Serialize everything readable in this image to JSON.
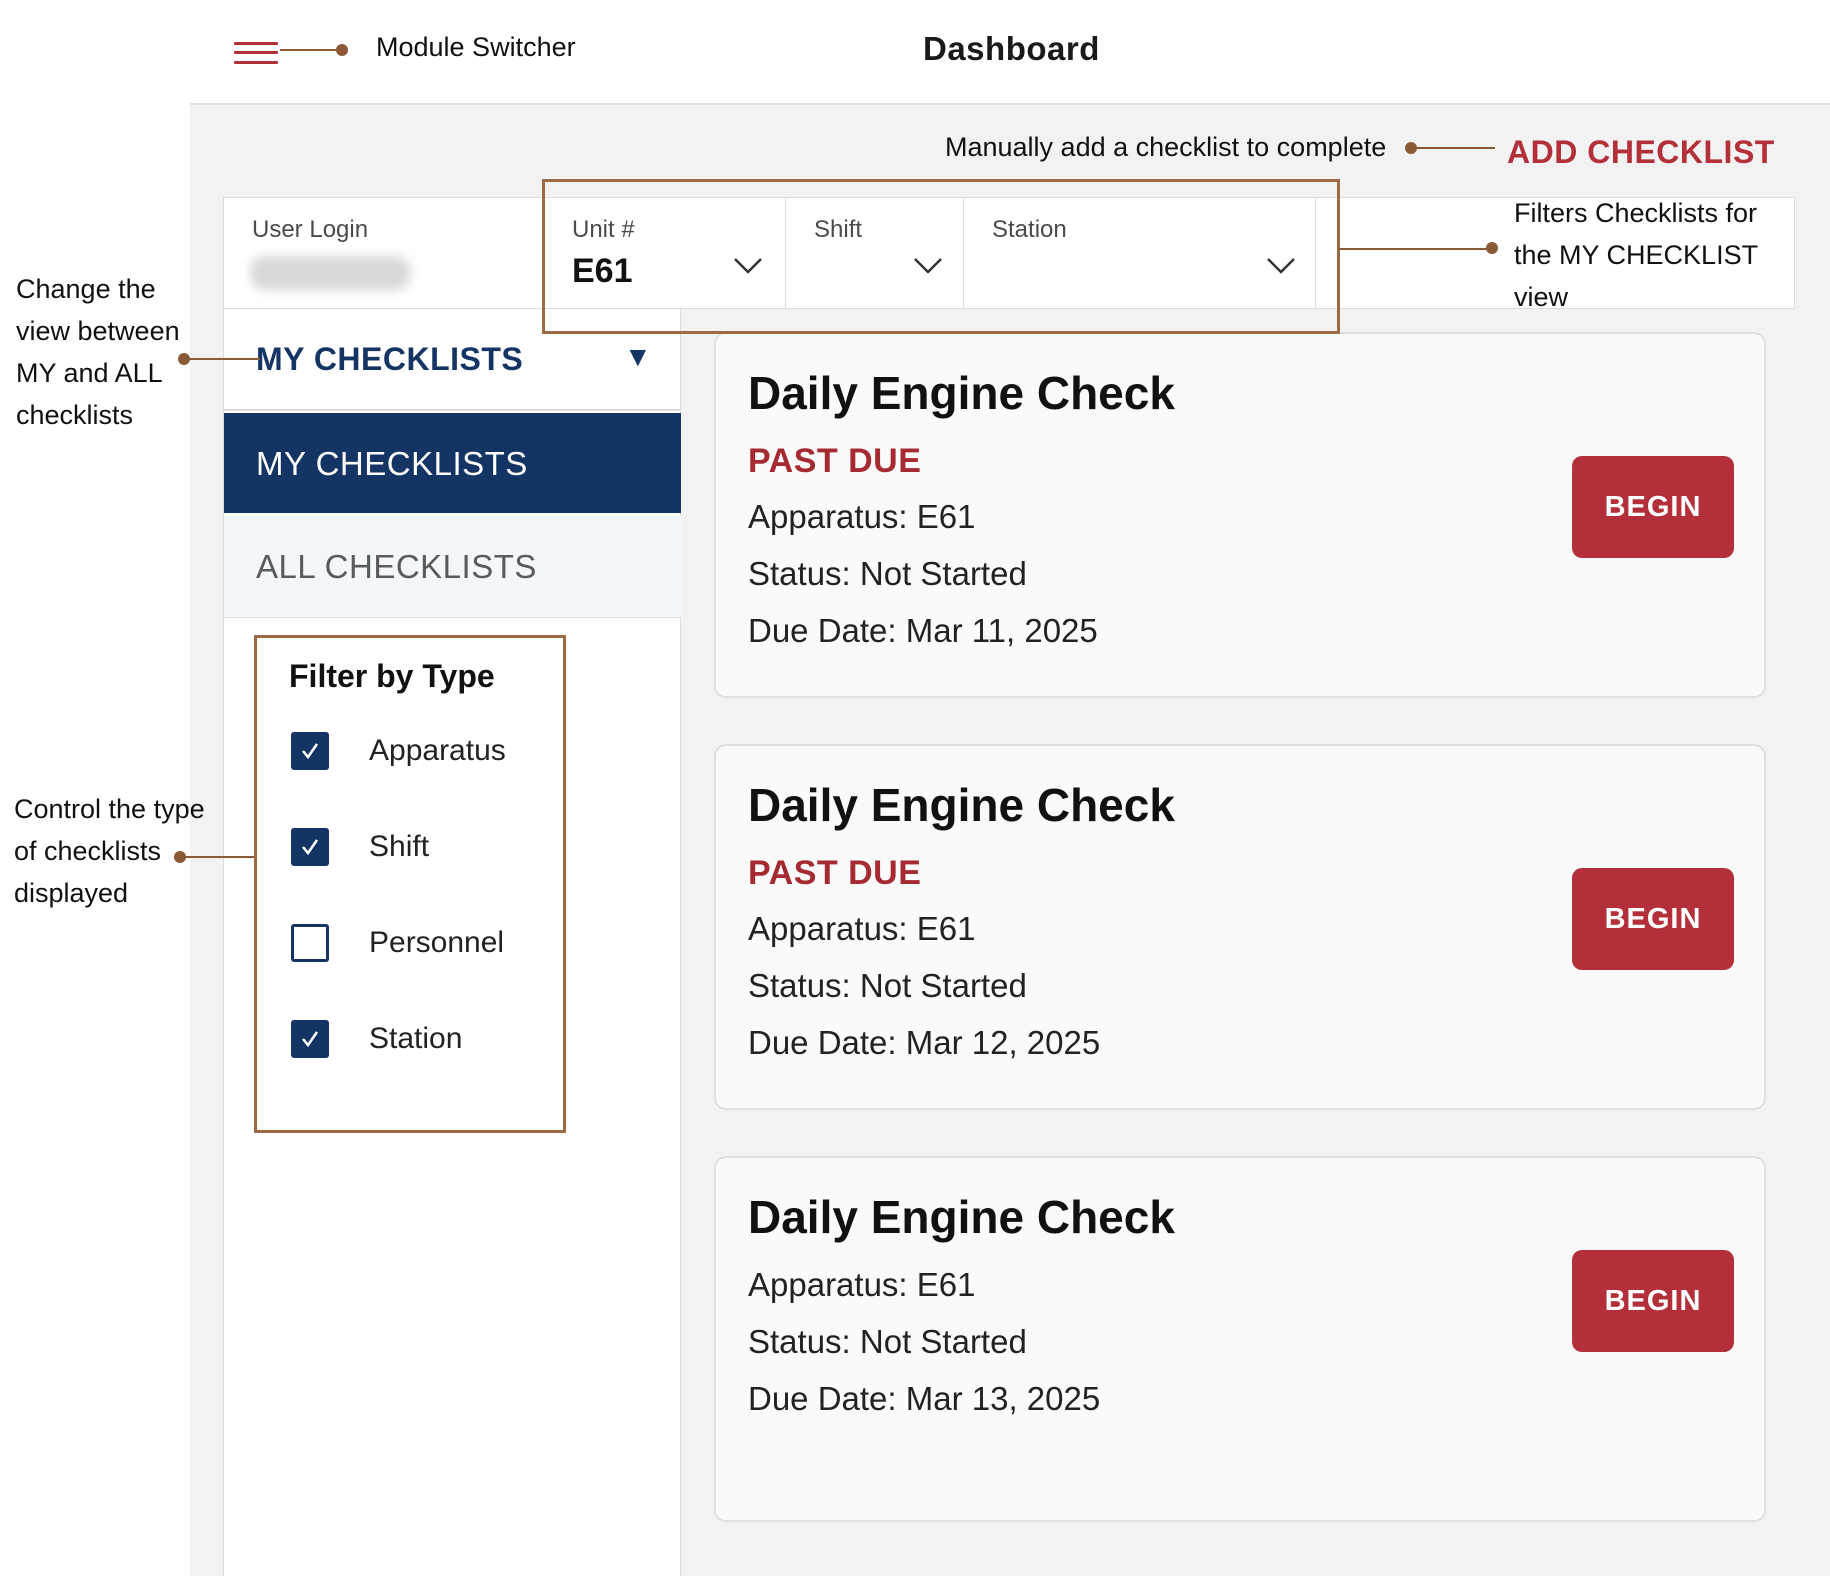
{
  "header": {
    "title": "Dashboard",
    "menu_icon": "hamburger-menu-icon",
    "accent_color": "#b3303a"
  },
  "toolbar": {
    "add_checklist_label": "ADD CHECKLIST"
  },
  "filters": {
    "user": {
      "label": "User Login",
      "value": ""
    },
    "unit": {
      "label": "Unit #",
      "value": "E61"
    },
    "shift": {
      "label": "Shift",
      "value": ""
    },
    "station": {
      "label": "Station",
      "value": ""
    }
  },
  "sidebar": {
    "view_selector": {
      "selected": "MY CHECKLISTS"
    },
    "view_options": [
      "MY CHECKLISTS",
      "ALL CHECKLISTS"
    ],
    "type_filter": {
      "title": "Filter by Type",
      "items": [
        {
          "label": "Apparatus",
          "checked": true
        },
        {
          "label": "Shift",
          "checked": true
        },
        {
          "label": "Personnel",
          "checked": false
        },
        {
          "label": "Station",
          "checked": true
        }
      ]
    },
    "primary_color": "#143464"
  },
  "checklists": [
    {
      "title": "Daily Engine Check",
      "badge": "PAST DUE",
      "apparatus": "Apparatus: E61",
      "status": "Status: Not Started",
      "due": "Due Date: Mar 11, 2025",
      "action": "BEGIN"
    },
    {
      "title": "Daily Engine Check",
      "badge": "PAST DUE",
      "apparatus": "Apparatus: E61",
      "status": "Status: Not Started",
      "due": "Due Date: Mar 12, 2025",
      "action": "BEGIN"
    },
    {
      "title": "Daily Engine Check",
      "badge": "",
      "apparatus": "Apparatus: E61",
      "status": "Status: Not Started",
      "due": "Due Date: Mar 13, 2025",
      "action": "BEGIN"
    }
  ],
  "annotations": {
    "module_switcher": "Module Switcher",
    "add_checklist": "Manually add a checklist to complete",
    "filters": [
      "Filters Checklists for",
      "the MY CHECKLIST",
      "view"
    ],
    "view_toggle": [
      "Change the",
      "view between",
      "MY and ALL",
      "checklists"
    ],
    "type_control": [
      "Control the type",
      "of checklists",
      "displayed"
    ]
  }
}
